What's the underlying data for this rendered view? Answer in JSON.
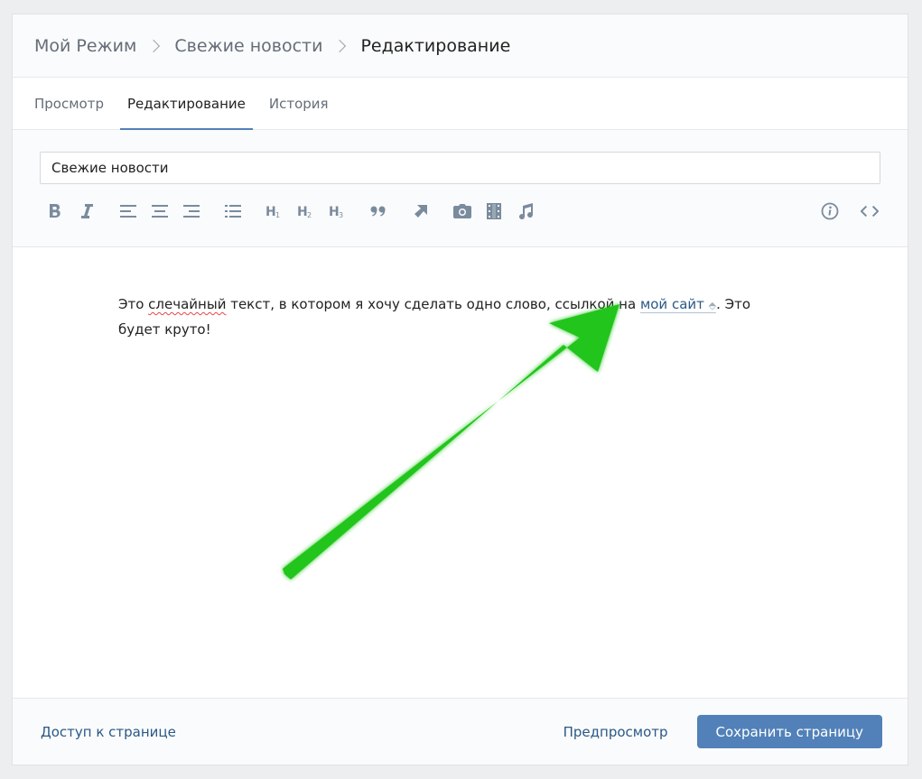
{
  "breadcrumb": {
    "items": [
      "Мой Режим",
      "Свежие новости"
    ],
    "current": "Редактирование"
  },
  "tabs": [
    {
      "label": "Просмотр",
      "active": false
    },
    {
      "label": "Редактирование",
      "active": true
    },
    {
      "label": "История",
      "active": false
    }
  ],
  "editor": {
    "title_value": "Свежие новости",
    "toolbar_icons": [
      "bold-icon",
      "italic-icon",
      "align-left-icon",
      "align-center-icon",
      "align-right-icon",
      "list-icon",
      "heading-1-icon",
      "heading-2-icon",
      "heading-3-icon",
      "quote-icon",
      "link-arrow-icon",
      "photo-icon",
      "video-icon",
      "audio-icon",
      "info-icon",
      "code-icon"
    ],
    "content": {
      "part1": "Это ",
      "misspelled": "слечайный",
      "part2": " текст, в котором я хочу сделать одно слово, ссылкой на ",
      "link_text": "мой сайт",
      "part3": ". Это будет круто!"
    }
  },
  "footer": {
    "access_label": "Доступ к странице",
    "preview_label": "Предпросмотр",
    "save_label": "Сохранить страницу"
  },
  "colors": {
    "accent": "#5181b8",
    "link": "#2a5885",
    "arrow": "#22c51a"
  }
}
